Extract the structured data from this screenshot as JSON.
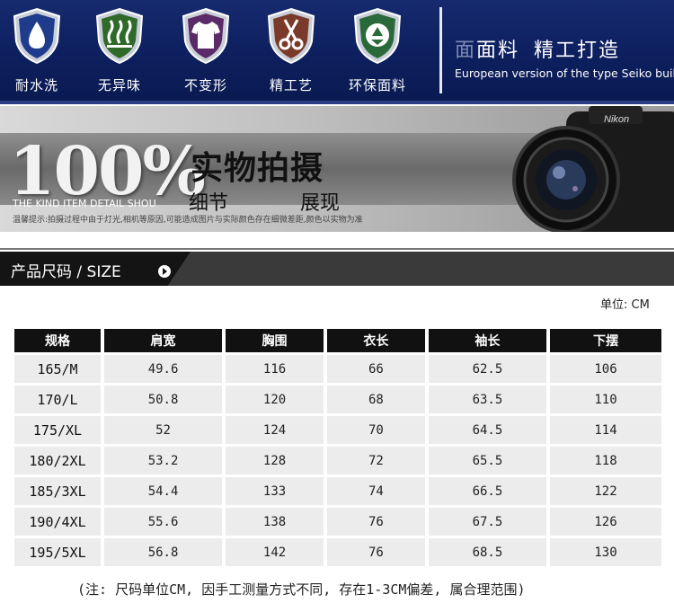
{
  "banner": {
    "features": [
      {
        "label": "耐水洗",
        "icon": "water-drop-icon",
        "color": "#1e3a8a"
      },
      {
        "label": "无异味",
        "icon": "steam-icon",
        "color": "#2f6a2a"
      },
      {
        "label": "不变形",
        "icon": "tshirt-icon",
        "color": "#5a2a6a"
      },
      {
        "label": "精工艺",
        "icon": "scissors-icon",
        "color": "#7a3a2a"
      },
      {
        "label": "环保面料",
        "icon": "recycle-icon",
        "color": "#2a6a3a"
      }
    ],
    "slogan_faded": "面",
    "slogan_cn_1": "面料",
    "slogan_cn_2": "精工打造",
    "slogan_en": "European version of the type Seiko build"
  },
  "photo": {
    "big_number": "100%",
    "title": "实物拍摄",
    "subtitle_en": "THE KIND ITEM DETAIL SHOU",
    "detail_1": "细节",
    "detail_2": "展现",
    "tip": "温馨提示:拍摄过程中由于灯光,相机等原因,可能造成图片与实际颜色存在细微差距,颜色以实物为准",
    "camera_brand": "Nikon"
  },
  "size_section": {
    "title": "产品尺码 / SIZE",
    "unit": "单位: CM"
  },
  "table": {
    "headers": [
      "规格",
      "肩宽",
      "胸围",
      "衣长",
      "袖长",
      "下摆"
    ],
    "rows": [
      [
        "165/M",
        "49.6",
        "116",
        "66",
        "62.5",
        "106"
      ],
      [
        "170/L",
        "50.8",
        "120",
        "68",
        "63.5",
        "110"
      ],
      [
        "175/XL",
        "52",
        "124",
        "70",
        "64.5",
        "114"
      ],
      [
        "180/2XL",
        "53.2",
        "128",
        "72",
        "65.5",
        "118"
      ],
      [
        "185/3XL",
        "54.4",
        "133",
        "74",
        "66.5",
        "122"
      ],
      [
        "190/4XL",
        "55.6",
        "138",
        "76",
        "67.5",
        "126"
      ],
      [
        "195/5XL",
        "56.8",
        "142",
        "76",
        "68.5",
        "130"
      ]
    ]
  },
  "note": "(注: 尺码单位CM, 因手工测量方式不同, 存在1-3CM偏差, 属合理范围)"
}
